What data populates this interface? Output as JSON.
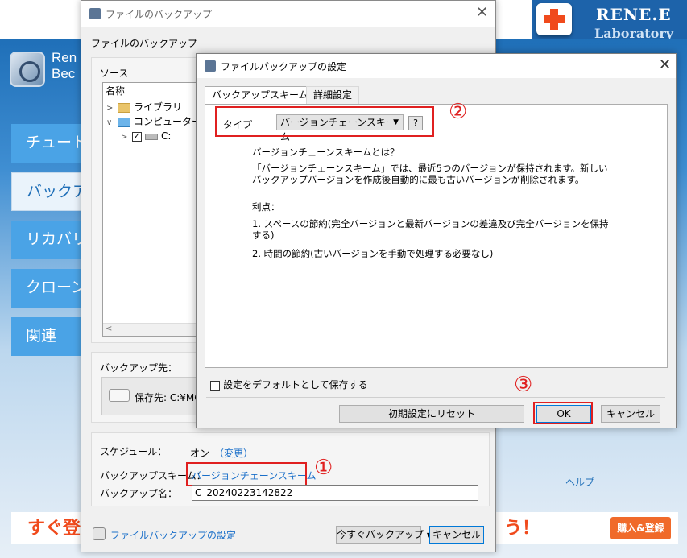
{
  "brand": {
    "name": "RENE.E",
    "sub": "Laboratory"
  },
  "bg_app": {
    "title_line1": "Ren",
    "title_line2": "Bec",
    "nav": [
      "チュートリ",
      "バックア",
      "リカバリ",
      "クローン",
      "関連"
    ],
    "help": "ヘルプ",
    "promo_left": "すぐ登",
    "promo_right": "う！",
    "buy_button": "購入&登録"
  },
  "backup_window": {
    "title": "ファイルのバックアップ",
    "heading": "ファイルのバックアップ",
    "source_label": "ソース",
    "tree": {
      "header": "名称",
      "items": [
        "ライブラリ",
        "コンピューター",
        "C:"
      ]
    },
    "dest_label": "バックアップ先：",
    "dest_value": "保存先: C:¥MC",
    "schedule_label": "スケジュール：",
    "schedule_value": "オン",
    "schedule_link": "（変更）",
    "scheme_label": "バックアップスキーム：",
    "scheme_link": "バージョンチェーンスキーム",
    "name_label": "バックアップ名：",
    "name_value": "C_20240223142822",
    "footer_link": "ファイルバックアップの設定",
    "backup_now": "今すぐバックアップ",
    "cancel": "キャンセル"
  },
  "settings_dialog": {
    "title": "ファイルバックアップの設定",
    "tabs": [
      "バックアップスキーム",
      "詳細設定"
    ],
    "type_label": "タイプ",
    "type_value": "バージョンチェーンスキーム",
    "help_button": "?",
    "desc_title": "バージョンチェーンスキームとは？",
    "desc_body": "「バージョンチェーンスキーム」では、最近5つのバージョンが保持されます。新しいバックアップバージョンを作成後自動的に最も古いバージョンが削除されます。",
    "merits_label": "利点：",
    "merit1": "1. スペースの節約(完全バージョンと最新バージョンの差違及び完全バージョンを保持する)",
    "merit2": "2. 時間の節約(古いバージョンを手動で処理する必要なし)",
    "save_default": "設定をデフォルトとして保存する",
    "reset_button": "初期設定にリセット",
    "ok_button": "OK",
    "cancel_button": "キャンセル"
  },
  "annotations": [
    "①",
    "②",
    "③"
  ],
  "colors": {
    "highlight": "#e02020",
    "link": "#1a6fc9",
    "accent": "#1f6fb8",
    "promo": "#f04a1c"
  }
}
